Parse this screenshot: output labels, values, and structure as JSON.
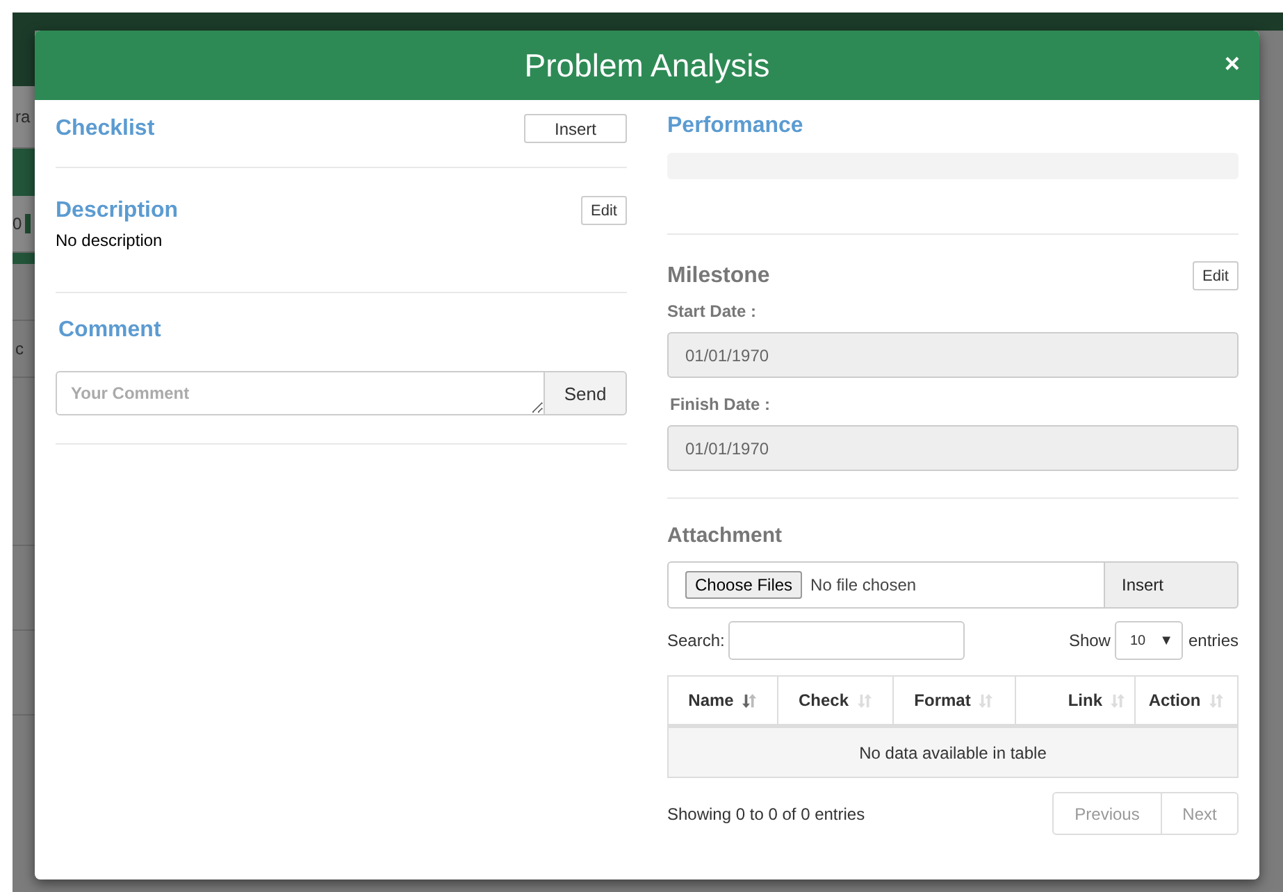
{
  "backdrop": {
    "fragments": [
      "ra",
      "0",
      "c"
    ]
  },
  "dialog": {
    "title": "Problem Analysis",
    "close": "×"
  },
  "checklist": {
    "heading": "Checklist",
    "button": "Insert"
  },
  "description": {
    "heading": "Description",
    "button": "Edit",
    "text": "No description"
  },
  "comment": {
    "heading": "Comment",
    "placeholder": "Your Comment",
    "button": "Send"
  },
  "performance": {
    "heading": "Performance",
    "level": 0
  },
  "milestone": {
    "heading": "Milestone",
    "button": "Edit",
    "fields": [
      {
        "label": "Start Date :",
        "value": "01/01/1970",
        "disabled": true
      },
      {
        "label": "Finish Date :",
        "value": "01/01/1970",
        "disabled": true
      }
    ]
  },
  "attachment": {
    "heading": "Attachment",
    "file_button": "Choose Files",
    "file_status": "No file chosen",
    "button": "Insert",
    "search_label": "Search:",
    "show_label": "Show",
    "page_size": "10",
    "caret": "▼",
    "entries_label": "entries",
    "columns": [
      {
        "label": "Name",
        "sorted": true
      },
      {
        "label": "Check",
        "sorted": false
      },
      {
        "label": "Format",
        "sorted": false
      },
      {
        "label": "Link",
        "sorted": false
      },
      {
        "label": "Action",
        "sorted": false
      }
    ],
    "empty_message": "No data available in table",
    "info": "Showing 0 to 0 of 0 entries",
    "pages": [
      {
        "label": "Previous",
        "disabled": true
      },
      {
        "label": "Next",
        "disabled": true
      }
    ]
  }
}
